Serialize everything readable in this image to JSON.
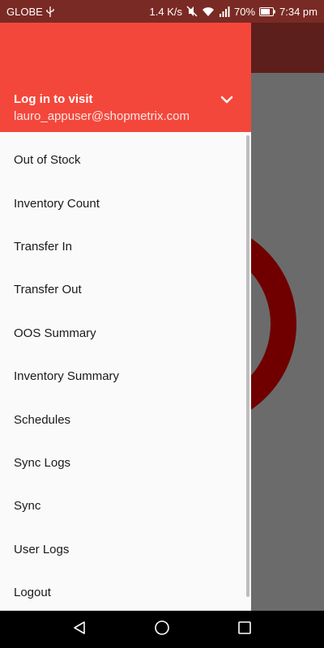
{
  "status_bar": {
    "carrier": "GLOBE",
    "net_speed": "1.4 K/s",
    "battery": "70%",
    "time": "7:34 pm"
  },
  "drawer": {
    "account_name": "Log in to visit",
    "account_email": "lauro_appuser@shopmetrix.com",
    "menu_items": [
      {
        "label": "Out of Stock"
      },
      {
        "label": "Inventory Count"
      },
      {
        "label": "Transfer In"
      },
      {
        "label": "Transfer Out"
      },
      {
        "label": "OOS Summary"
      },
      {
        "label": "Inventory Summary"
      },
      {
        "label": "Schedules"
      },
      {
        "label": "Sync Logs"
      },
      {
        "label": "Sync"
      },
      {
        "label": "User Logs"
      },
      {
        "label": "Logout"
      }
    ]
  },
  "icons": {
    "usb": "usb-icon",
    "mute": "vibrate-off-icon",
    "wifi": "wifi-icon",
    "signal": "signal-icon",
    "battery": "battery-icon",
    "expand": "chevron-down-icon",
    "back": "back-icon",
    "home": "home-icon",
    "recents": "recents-icon"
  },
  "colors": {
    "header": "#f4473b",
    "status_bar": "#7a2a25",
    "drawer_bg": "#fafafa",
    "scrim_accent": "#700000"
  }
}
